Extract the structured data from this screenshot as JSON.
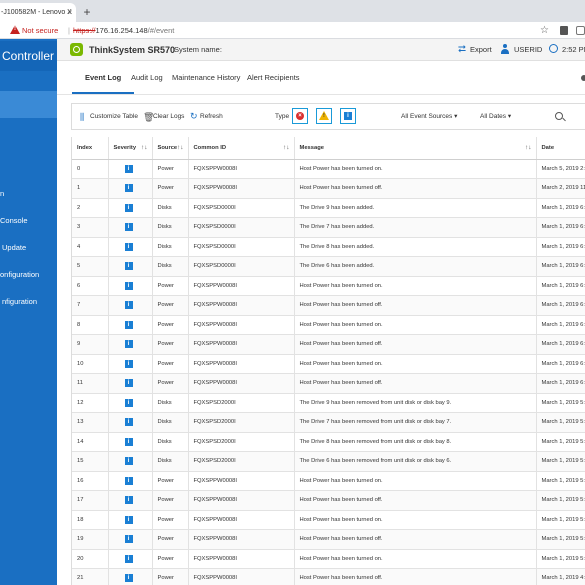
{
  "browser": {
    "tab_title": "-J100582M - Lenovo X",
    "tab_close": "×",
    "new_tab": "+",
    "not_secure": "Not secure",
    "url_scheme": "https://",
    "url_host": "176.16.254.148",
    "url_path": "/#/event",
    "star": "☆"
  },
  "sidebar": {
    "title": "Controller",
    "items": [
      {
        "label": "n"
      },
      {
        "label": "Console"
      },
      {
        "label": "Update"
      },
      {
        "label": "onfiguration"
      },
      {
        "label": "nfiguration"
      }
    ]
  },
  "header": {
    "model": "ThinkSystem SR570",
    "system_name_label": "System name:",
    "export_label": "Export",
    "user_label": "USERID",
    "time": "2:52 PM"
  },
  "tabs": [
    {
      "label": "Event Log",
      "active": true
    },
    {
      "label": "Audit Log",
      "active": false
    },
    {
      "label": "Maintenance History",
      "active": false
    },
    {
      "label": "Alert Recipients",
      "active": false
    }
  ],
  "toolbar": {
    "customize_label": "Customize Table",
    "clear_label": "Clear Logs",
    "refresh_label": "Refresh",
    "type_label": "Type",
    "sources_label": "All Event Sources",
    "dates_label": "All Dates"
  },
  "table": {
    "columns": [
      "Index",
      "Severity",
      "Source",
      "Common ID",
      "Message",
      "Date"
    ],
    "rows": [
      {
        "index": "0",
        "source": "Power",
        "id": "FQXSPPW0008I",
        "message": "Host Power has been turned on.",
        "date": "March 5, 2019 2:32:13 PM"
      },
      {
        "index": "1",
        "source": "Power",
        "id": "FQXSPPW0008I",
        "message": "Host Power has been turned off.",
        "date": "March 2, 2019 11:29:51 AM"
      },
      {
        "index": "2",
        "source": "Disks",
        "id": "FQXSPSD0000I",
        "message": "The Drive 9 has been added.",
        "date": "March 1, 2019 6:30:44 PM"
      },
      {
        "index": "3",
        "source": "Disks",
        "id": "FQXSPSD0000I",
        "message": "The Drive 7 has been added.",
        "date": "March 1, 2019 6:30:32 PM"
      },
      {
        "index": "4",
        "source": "Disks",
        "id": "FQXSPSD0000I",
        "message": "The Drive 8 has been added.",
        "date": "March 1, 2019 6:30:20 PM"
      },
      {
        "index": "5",
        "source": "Disks",
        "id": "FQXSPSD0000I",
        "message": "The Drive 6 has been added.",
        "date": "March 1, 2019 6:30:08 PM"
      },
      {
        "index": "6",
        "source": "Power",
        "id": "FQXSPPW0008I",
        "message": "Host Power has been turned on.",
        "date": "March 1, 2019 6:29:58 PM"
      },
      {
        "index": "7",
        "source": "Power",
        "id": "FQXSPPW0008I",
        "message": "Host Power has been turned off.",
        "date": "March 1, 2019 6:24:10 PM"
      },
      {
        "index": "8",
        "source": "Power",
        "id": "FQXSPPW0008I",
        "message": "Host Power has been turned on.",
        "date": "March 1, 2019 6:14:32 PM"
      },
      {
        "index": "9",
        "source": "Power",
        "id": "FQXSPPW0008I",
        "message": "Host Power has been turned off.",
        "date": "March 1, 2019 6:14:02 PM"
      },
      {
        "index": "10",
        "source": "Power",
        "id": "FQXSPPW0008I",
        "message": "Host Power has been turned on.",
        "date": "March 1, 2019 6:12:40 PM"
      },
      {
        "index": "11",
        "source": "Power",
        "id": "FQXSPPW0008I",
        "message": "Host Power has been turned off.",
        "date": "March 1, 2019 6:12:05 PM"
      },
      {
        "index": "12",
        "source": "Disks",
        "id": "FQXSPSD2000I",
        "message": "The Drive 9 has been removed from unit disk or disk bay 9.",
        "date": "March 1, 2019 5:37:41 PM"
      },
      {
        "index": "13",
        "source": "Disks",
        "id": "FQXSPSD2000I",
        "message": "The Drive 7 has been removed from unit disk or disk bay 7.",
        "date": "March 1, 2019 5:37:29 PM"
      },
      {
        "index": "14",
        "source": "Disks",
        "id": "FQXSPSD2000I",
        "message": "The Drive 8 has been removed from unit disk or disk bay 8.",
        "date": "March 1, 2019 5:37:17 PM"
      },
      {
        "index": "15",
        "source": "Disks",
        "id": "FQXSPSD2000I",
        "message": "The Drive 6 has been removed from unit disk or disk bay 6.",
        "date": "March 1, 2019 5:37:05 PM"
      },
      {
        "index": "16",
        "source": "Power",
        "id": "FQXSPPW0008I",
        "message": "Host Power has been turned on.",
        "date": "March 1, 2019 5:37:00 PM"
      },
      {
        "index": "17",
        "source": "Power",
        "id": "FQXSPPW0008I",
        "message": "Host Power has been turned off.",
        "date": "March 1, 2019 5:36:11 PM"
      },
      {
        "index": "18",
        "source": "Power",
        "id": "FQXSPPW0008I",
        "message": "Host Power has been turned on.",
        "date": "March 1, 2019 5:33:50 PM"
      },
      {
        "index": "19",
        "source": "Power",
        "id": "FQXSPPW0008I",
        "message": "Host Power has been turned off.",
        "date": "March 1, 2019 5:33:02 PM"
      },
      {
        "index": "20",
        "source": "Power",
        "id": "FQXSPPW0008I",
        "message": "Host Power has been turned on.",
        "date": "March 1, 2019 5:29:45 PM"
      },
      {
        "index": "21",
        "source": "Power",
        "id": "FQXSPPW0008I",
        "message": "Host Power has been turned off.",
        "date": "March 1, 2019 4:17:20 PM"
      }
    ]
  },
  "icons": {
    "severity": "info-icon",
    "accent": "#1a6fc2"
  }
}
